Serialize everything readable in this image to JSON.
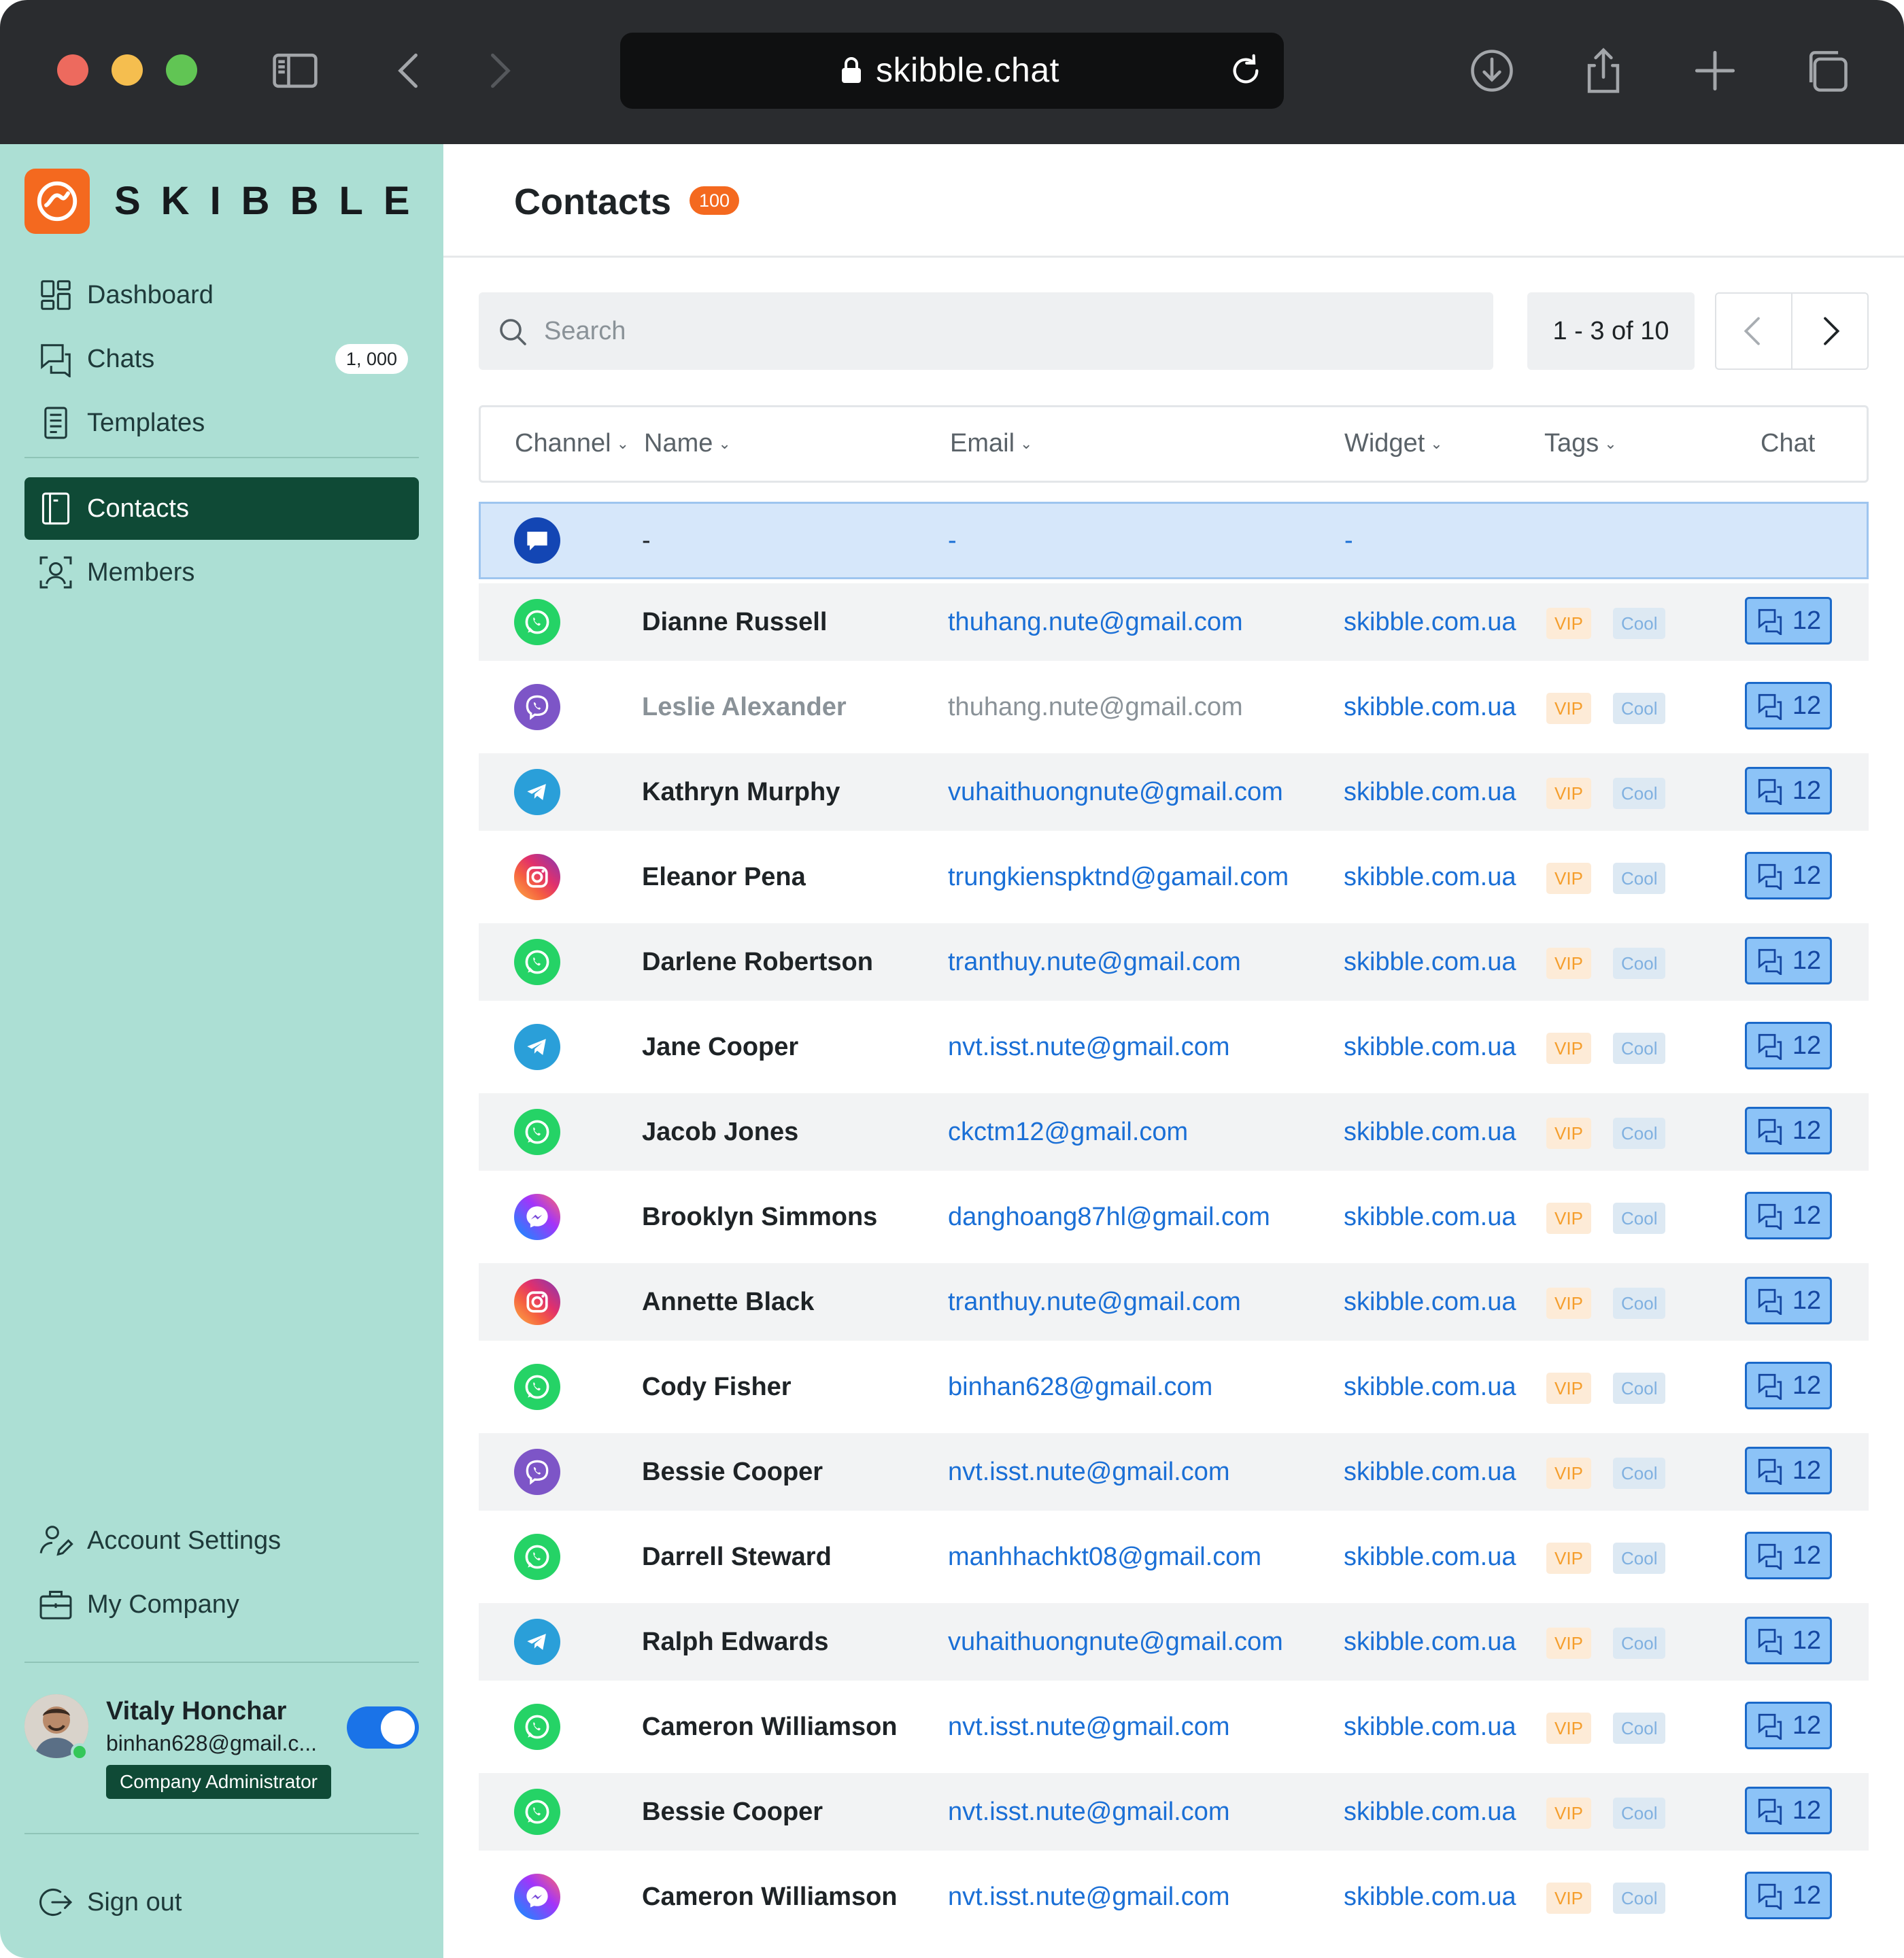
{
  "browser": {
    "url": "skibble.chat",
    "icons": [
      "sidebar-toggle-icon",
      "back-icon",
      "forward-icon",
      "lock-icon",
      "reload-icon",
      "download-icon",
      "share-icon",
      "new-tab-icon",
      "tabs-overview-icon"
    ]
  },
  "brand": {
    "name": "SKIBBLE",
    "color": "#f4691f"
  },
  "sidebar": {
    "nav_top": [
      {
        "label": "Dashboard",
        "icon": "dashboard-icon"
      },
      {
        "label": "Chats",
        "icon": "chats-icon",
        "badge": "1, 000"
      },
      {
        "label": "Templates",
        "icon": "templates-icon"
      }
    ],
    "nav_mid": [
      {
        "label": "Contacts",
        "icon": "contacts-icon",
        "active": true
      },
      {
        "label": "Members",
        "icon": "members-icon"
      }
    ],
    "nav_bottom": [
      {
        "label": "Account Settings",
        "icon": "account-settings-icon"
      },
      {
        "label": "My Company",
        "icon": "briefcase-icon"
      }
    ],
    "profile": {
      "name": "Vitaly Honchar",
      "email": "binhan628@gmail.c...",
      "role": "Company Administrator",
      "online": true,
      "toggle_on": true
    },
    "sign_out": "Sign out",
    "accent": "#0f4a36"
  },
  "main": {
    "title": "Contacts",
    "count_badge": "100",
    "search_placeholder": "Search",
    "pagination": "1 - 3 of 10",
    "columns": {
      "channel": "Channel",
      "name": "Name",
      "email": "Email",
      "widget": "Widget",
      "tags": "Tags",
      "chat": "Chat"
    },
    "tags": {
      "vip": "VIP",
      "cool": "Cool"
    },
    "selected_row": {
      "channel": "web-chat",
      "name": "-",
      "email": "-",
      "widget": "-"
    },
    "rows": [
      {
        "channel": "whatsapp",
        "name": "Dianne Russell",
        "email": "thuhang.nute@gmail.com",
        "widget": "skibble.com.ua",
        "chat": "12"
      },
      {
        "channel": "viber",
        "name": "Leslie Alexander",
        "email": "thuhang.nute@gmail.com",
        "widget": "skibble.com.ua",
        "chat": "12",
        "muted": true
      },
      {
        "channel": "telegram",
        "name": "Kathryn Murphy",
        "email": "vuhaithuongnute@gmail.com",
        "widget": "skibble.com.ua",
        "chat": "12"
      },
      {
        "channel": "instagram",
        "name": "Eleanor Pena",
        "email": "trungkienspktnd@gamail.com",
        "widget": "skibble.com.ua",
        "chat": "12"
      },
      {
        "channel": "whatsapp",
        "name": "Darlene Robertson",
        "email": "tranthuy.nute@gmail.com",
        "widget": "skibble.com.ua",
        "chat": "12"
      },
      {
        "channel": "telegram",
        "name": "Jane Cooper",
        "email": "nvt.isst.nute@gmail.com",
        "widget": "skibble.com.ua",
        "chat": "12"
      },
      {
        "channel": "whatsapp",
        "name": "Jacob Jones",
        "email": "ckctm12@gmail.com",
        "widget": "skibble.com.ua",
        "chat": "12"
      },
      {
        "channel": "messenger",
        "name": "Brooklyn Simmons",
        "email": "danghoang87hl@gmail.com",
        "widget": "skibble.com.ua",
        "chat": "12"
      },
      {
        "channel": "instagram",
        "name": "Annette Black",
        "email": "tranthuy.nute@gmail.com",
        "widget": "skibble.com.ua",
        "chat": "12"
      },
      {
        "channel": "whatsapp",
        "name": "Cody Fisher",
        "email": "binhan628@gmail.com",
        "widget": "skibble.com.ua",
        "chat": "12"
      },
      {
        "channel": "viber",
        "name": "Bessie Cooper",
        "email": "nvt.isst.nute@gmail.com",
        "widget": "skibble.com.ua",
        "chat": "12"
      },
      {
        "channel": "whatsapp",
        "name": "Darrell Steward",
        "email": "manhhachkt08@gmail.com",
        "widget": "skibble.com.ua",
        "chat": "12"
      },
      {
        "channel": "telegram",
        "name": "Ralph Edwards",
        "email": "vuhaithuongnute@gmail.com",
        "widget": "skibble.com.ua",
        "chat": "12"
      },
      {
        "channel": "whatsapp",
        "name": "Cameron Williamson",
        "email": "nvt.isst.nute@gmail.com",
        "widget": "skibble.com.ua",
        "chat": "12"
      },
      {
        "channel": "whatsapp",
        "name": "Bessie Cooper",
        "email": "nvt.isst.nute@gmail.com",
        "widget": "skibble.com.ua",
        "chat": "12"
      },
      {
        "channel": "messenger",
        "name": "Cameron Williamson",
        "email": "nvt.isst.nute@gmail.com",
        "widget": "skibble.com.ua",
        "chat": "12"
      }
    ],
    "colors": {
      "link": "#1a6fd6",
      "selected_row": "#d6e7fa",
      "whatsapp": "#25d366",
      "viber": "#7d55c7",
      "telegram": "#2a9fd9",
      "web-chat": "#1346b4"
    }
  }
}
